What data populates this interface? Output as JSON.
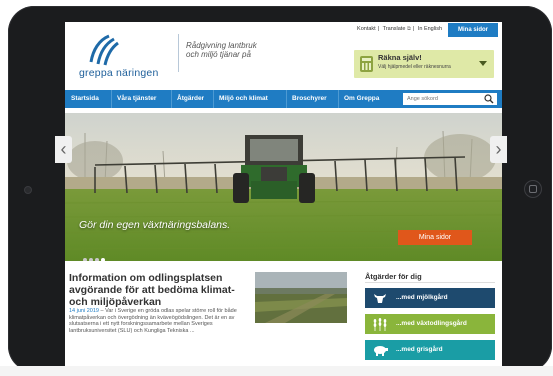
{
  "toplinks": {
    "kontakt": "Kontakt",
    "translate": "Translate",
    "english": "In English",
    "mina_sidor": "Mina sidor"
  },
  "logo": {
    "name": "greppa näringen"
  },
  "tagline": {
    "line1": "Rådgivning lantbruk",
    "line2": "och miljö tjänar på"
  },
  "calculator": {
    "title": "Räkna själv!",
    "subtitle": "Välj hjälpmedel eller räknesnurra"
  },
  "nav": {
    "items": [
      "Startsida",
      "Våra tjänster",
      "Åtgärder",
      "Miljö och klimat",
      "Broschyrer",
      "Om Greppa"
    ],
    "search_placeholder": "Ange sökord"
  },
  "hero": {
    "caption": "Gör din egen växtnäringsbalans.",
    "button": "Mina sidor",
    "slides": 4,
    "active_slide": 4
  },
  "news": {
    "title": "Information om odlingsplatsen avgörande för att bedöma klimat- och miljöpåverkan",
    "date": "14 juni 2019",
    "excerpt": "– Var i Sverige en gröda odlas spelar större roll för både klimatpåverkan och övergödning än kväveögödslingen. Det är en av slutsatserna i ett nytt forskningssamarbete mellan Sveriges lantbruksuniversitet (SLU) och Kungliga Tekniska ..."
  },
  "actions": {
    "title": "Åtgärder för dig",
    "items": [
      {
        "label": "...med mjölkgård",
        "color": "#1e4a6e",
        "icon": "cow-icon"
      },
      {
        "label": "...med växtodlingsgård",
        "color": "#8ab53b",
        "icon": "wheat-icon"
      },
      {
        "label": "...med grisgård",
        "color": "#1a9da5",
        "icon": "pig-icon"
      }
    ]
  },
  "colors": {
    "brand_blue": "#1f7cc3",
    "hero_button": "#e0571b",
    "calculator_bg": "#dfe9a7"
  }
}
